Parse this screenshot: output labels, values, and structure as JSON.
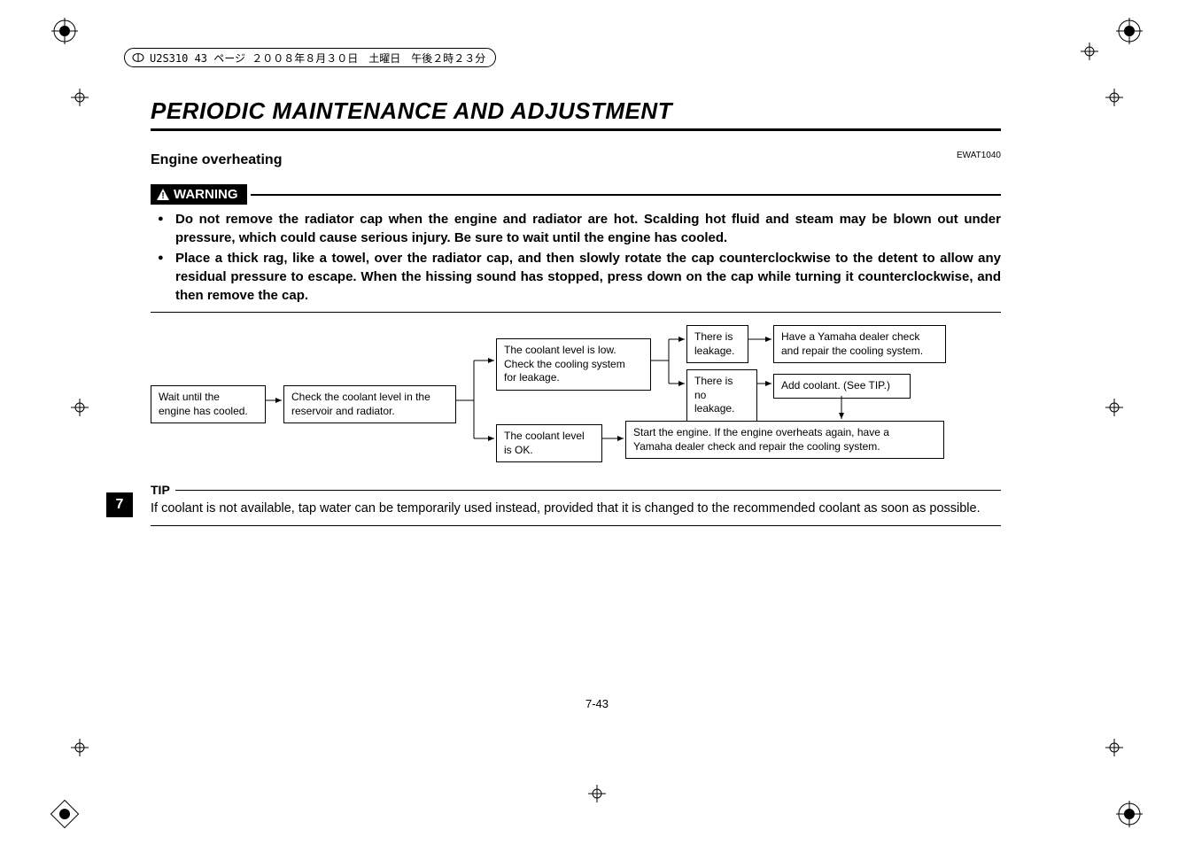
{
  "meta_header": "U2S310 43 ページ ２００８年８月３０日　土曜日　午後２時２３分",
  "chapter_title": "PERIODIC MAINTENANCE AND ADJUSTMENT",
  "section_title": "Engine overheating",
  "doc_code": "EWAT1040",
  "warning_label": "WARNING",
  "warnings": [
    "Do not remove the radiator cap when the engine and radiator are hot. Scalding hot fluid and steam may be blown out under pressure, which could cause serious injury. Be sure to wait until the engine has cooled.",
    "Place a thick rag, like a towel, over the radiator cap, and then slowly rotate the cap counterclockwise to the detent to allow any residual pressure to escape. When the hissing sound has stopped, press down on the cap while turning it counterclockwise, and then remove the cap."
  ],
  "flow": {
    "box1": "Wait until the\nengine has cooled.",
    "box2": "Check the coolant level in the\nreservoir and radiator.",
    "box3": "The coolant level is low.\nCheck the cooling system\nfor leakage.",
    "box4": "The coolant level\nis OK.",
    "box5": "There is\nleakage.",
    "box6": "There is\nno leakage.",
    "box7": "Have a Yamaha dealer check\nand repair the cooling system.",
    "box8": "Add coolant. (See TIP.)",
    "box9": "Start the engine. If the engine overheats again, have a\nYamaha dealer check and repair the cooling system."
  },
  "tip_label": "TIP",
  "tip_text": "If coolant is not available, tap water can be temporarily used instead, provided that it is changed to the recommended coolant as soon as possible.",
  "page_tab": "7",
  "page_number": "7-43"
}
